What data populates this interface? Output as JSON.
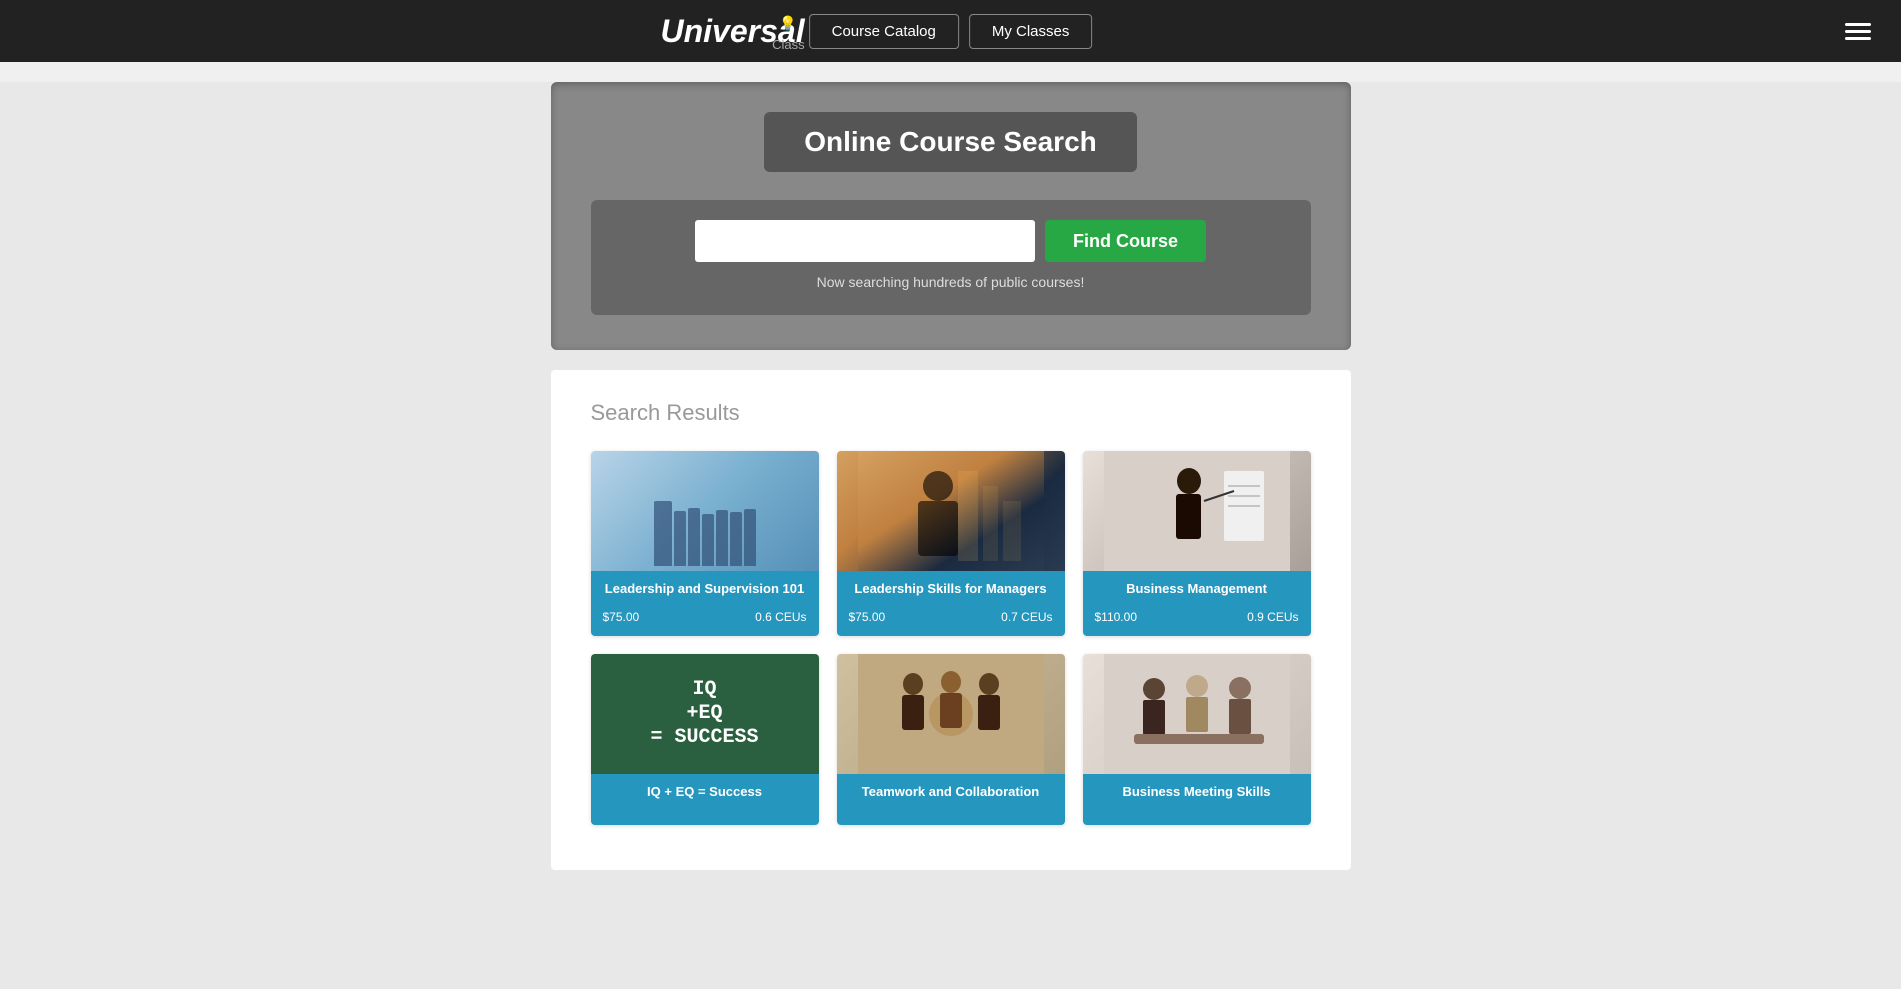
{
  "header": {
    "logo_main": "Universal",
    "logo_sub": "Class",
    "nav": {
      "catalog_label": "Course Catalog",
      "myclasses_label": "My Classes"
    }
  },
  "search_section": {
    "title": "Online Course Search",
    "button_label": "Find Course",
    "subtitle": "Now searching hundreds of public courses!",
    "input_placeholder": ""
  },
  "results": {
    "heading": "Search Results",
    "courses": [
      {
        "title": "Leadership and Supervision 101",
        "price": "$75.00",
        "ceus": "0.6 CEUs",
        "img_type": "leadership1"
      },
      {
        "title": "Leadership Skills for Managers",
        "price": "$75.00",
        "ceus": "0.7 CEUs",
        "img_type": "leadership2"
      },
      {
        "title": "Business Management",
        "price": "$110.00",
        "ceus": "0.9 CEUs",
        "img_type": "business"
      },
      {
        "title": "IQ + EQ = Success",
        "price": "",
        "ceus": "",
        "img_type": "iq"
      },
      {
        "title": "Teamwork and Collaboration",
        "price": "",
        "ceus": "",
        "img_type": "teamwork"
      },
      {
        "title": "Business Meeting Skills",
        "price": "",
        "ceus": "",
        "img_type": "meeting"
      }
    ]
  }
}
